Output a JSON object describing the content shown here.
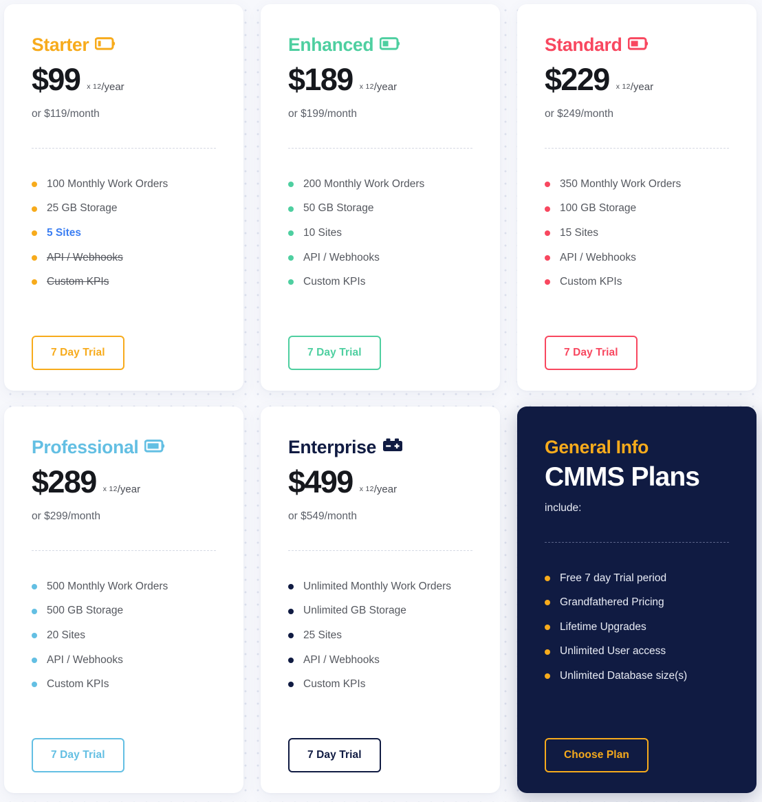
{
  "page": {
    "background": "#f7f8fc",
    "link_color": "#3b7ef2"
  },
  "plans": [
    {
      "name": "Starter",
      "accent": "#f7ab1c",
      "icon": "battery-quarter-icon",
      "battery_fill": 0.22,
      "price": "$99",
      "multiplier": "x 12",
      "period": "/year",
      "monthly": "or $119/month",
      "features": [
        {
          "text": "100 Monthly Work Orders",
          "state": "normal"
        },
        {
          "text": "25 GB Storage",
          "state": "normal"
        },
        {
          "text": "5 Sites",
          "state": "link"
        },
        {
          "text": "API / Webhooks",
          "state": "struck"
        },
        {
          "text": "Custom KPIs",
          "state": "struck"
        }
      ],
      "cta": "7 Day Trial"
    },
    {
      "name": "Enhanced",
      "accent": "#4ecfa0",
      "icon": "battery-low-icon",
      "battery_fill": 0.4,
      "price": "$189",
      "multiplier": "x 12",
      "period": "/year",
      "monthly": "or $199/month",
      "features": [
        {
          "text": "200 Monthly Work Orders",
          "state": "normal"
        },
        {
          "text": "50 GB Storage",
          "state": "normal"
        },
        {
          "text": "10 Sites",
          "state": "normal"
        },
        {
          "text": "API / Webhooks",
          "state": "normal"
        },
        {
          "text": "Custom KPIs",
          "state": "normal"
        }
      ],
      "cta": "7 Day Trial"
    },
    {
      "name": "Standard",
      "accent": "#f8475f",
      "icon": "battery-half-icon",
      "battery_fill": 0.52,
      "price": "$229",
      "multiplier": "x 12",
      "period": "/year",
      "monthly": "or $249/month",
      "features": [
        {
          "text": "350 Monthly Work Orders",
          "state": "normal"
        },
        {
          "text": "100 GB Storage",
          "state": "normal"
        },
        {
          "text": "15 Sites",
          "state": "normal"
        },
        {
          "text": "API / Webhooks",
          "state": "normal"
        },
        {
          "text": "Custom KPIs",
          "state": "normal"
        }
      ],
      "cta": "7 Day Trial"
    },
    {
      "name": "Professional",
      "accent": "#63bfe3",
      "icon": "battery-high-icon",
      "battery_fill": 0.82,
      "price": "$289",
      "multiplier": "x 12",
      "period": "/year",
      "monthly": "or $299/month",
      "features": [
        {
          "text": "500 Monthly Work Orders",
          "state": "normal"
        },
        {
          "text": "500 GB Storage",
          "state": "normal"
        },
        {
          "text": "20 Sites",
          "state": "normal"
        },
        {
          "text": "API / Webhooks",
          "state": "normal"
        },
        {
          "text": "Custom KPIs",
          "state": "normal"
        }
      ],
      "cta": "7 Day Trial"
    },
    {
      "name": "Enterprise",
      "accent": "#101b42",
      "icon": "car-battery-icon",
      "battery_fill": 1,
      "price": "$499",
      "multiplier": "x 12",
      "period": "/year",
      "monthly": "or $549/month",
      "features": [
        {
          "text": "Unlimited Monthly Work Orders",
          "state": "normal"
        },
        {
          "text": "Unlimited GB Storage",
          "state": "normal"
        },
        {
          "text": "25 Sites",
          "state": "normal"
        },
        {
          "text": "API / Webhooks",
          "state": "normal"
        },
        {
          "text": "Custom KPIs",
          "state": "normal"
        }
      ],
      "cta": "7 Day Trial"
    }
  ],
  "info_card": {
    "eyebrow": "General Info",
    "title": "CMMS Plans",
    "subtitle": "include:",
    "accent": "#f7ab1c",
    "background": "#101b42",
    "features": [
      "Free 7 day Trial period",
      "Grandfathered Pricing",
      "Lifetime Upgrades",
      "Unlimited User access",
      "Unlimited Database size(s)"
    ],
    "cta": "Choose Plan"
  }
}
